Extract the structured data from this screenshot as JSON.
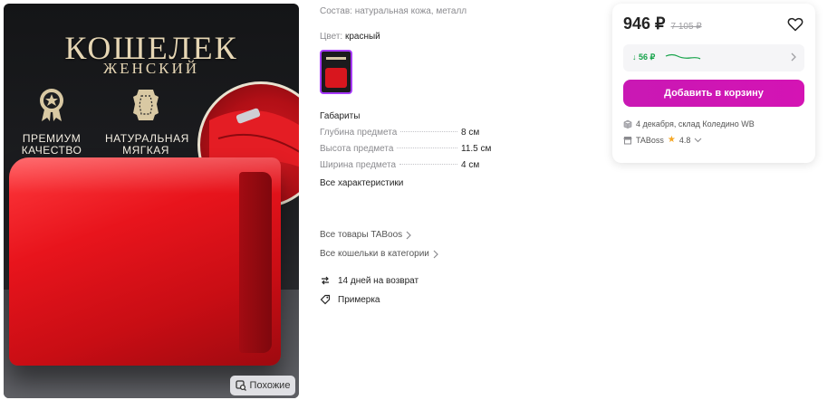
{
  "product_image": {
    "title": "КОШЕЛЕК",
    "subtitle": "ЖЕНСКИЙ",
    "badges": [
      {
        "label": "ПРЕМИУМ\nКАЧЕСТВО",
        "icon": "rosette-star-icon"
      },
      {
        "label": "НАТУРАЛЬНАЯ\nМЯГКАЯ КОЖА",
        "icon": "leather-hide-icon"
      }
    ],
    "similar_label": "Похожие",
    "colors": {
      "wallet": "#e8141c",
      "text": "#e6d6b4"
    }
  },
  "details": {
    "composition_label": "Состав:",
    "composition_value": "натуральная кожа, металл",
    "color_label": "Цвет:",
    "color_value": "красный",
    "dimensions_title": "Габариты",
    "dimensions": [
      {
        "name": "Глубина предмета",
        "value": "8 см"
      },
      {
        "name": "Высота предмета",
        "value": "11.5 см"
      },
      {
        "name": "Ширина предмета",
        "value": "4 см"
      }
    ],
    "all_specs_link": "Все характеристики",
    "brand_link": "Все товары TABoos",
    "category_link": "Все кошельки в категории",
    "features": [
      {
        "label": "14 дней на возврат",
        "icon": "return-arrows-icon"
      },
      {
        "label": "Примерка",
        "icon": "tag-icon"
      }
    ]
  },
  "buy_card": {
    "price": "946 ₽",
    "old_price": "7 105 ₽",
    "wallet_discount": "↓ 56 ₽",
    "add_to_cart_label": "Добавить в корзину",
    "delivery": "4 декабря, склад Коледино WB",
    "seller_name": "TABoss",
    "seller_rating": "4.8",
    "accent_color": "#cb11ab",
    "discount_color": "#16a34a"
  }
}
